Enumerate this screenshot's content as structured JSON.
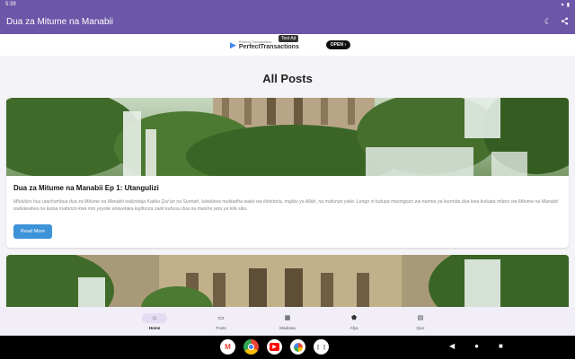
{
  "status_bar": {
    "time": "5:39"
  },
  "app_bar": {
    "title": "Dua za Mitume na Manabii",
    "theme_icon": "moon-icon",
    "share_icon": "share-icon"
  },
  "ad": {
    "small_text": "Perfect Transactions",
    "brand": "PerfectTransactions",
    "tag": "Test Ad",
    "cta": "OPEN"
  },
  "main": {
    "title": "All Posts",
    "posts": [
      {
        "title": "Dua za Mitume na Manabii Ep 1: Utangulizi",
        "description": "Mfululizo huu utachambua dua za Mitume na Manabii walizotaja Katika Qur'an na Sunnah, tukielewa muktadha wake wa kihistoria, majibu ya Allah, na mafunzo yake. Lengo ni kutupa mwongozo wa namna ya kuomba dua kwa kufuata mfano wa Mitume na Manabii walioteuliwa na kutoa mafunzo kwa mtu yeyote anayetaka kujifunza zaidi kuhusu dua na maisha yetu ya kila siku.",
        "button": "Read More"
      }
    ]
  },
  "bottom_nav": [
    {
      "label": "Home",
      "icon": "home-icon",
      "active": true
    },
    {
      "label": "Posts",
      "icon": "book-icon",
      "active": false
    },
    {
      "label": "Madrasa",
      "icon": "building-icon",
      "active": false
    },
    {
      "label": "Afya",
      "icon": "shield-icon",
      "active": false
    },
    {
      "label": "Quiz",
      "icon": "quiz-icon",
      "active": false
    }
  ],
  "colors": {
    "primary": "#6b56a8",
    "accent": "#3d93d8"
  }
}
